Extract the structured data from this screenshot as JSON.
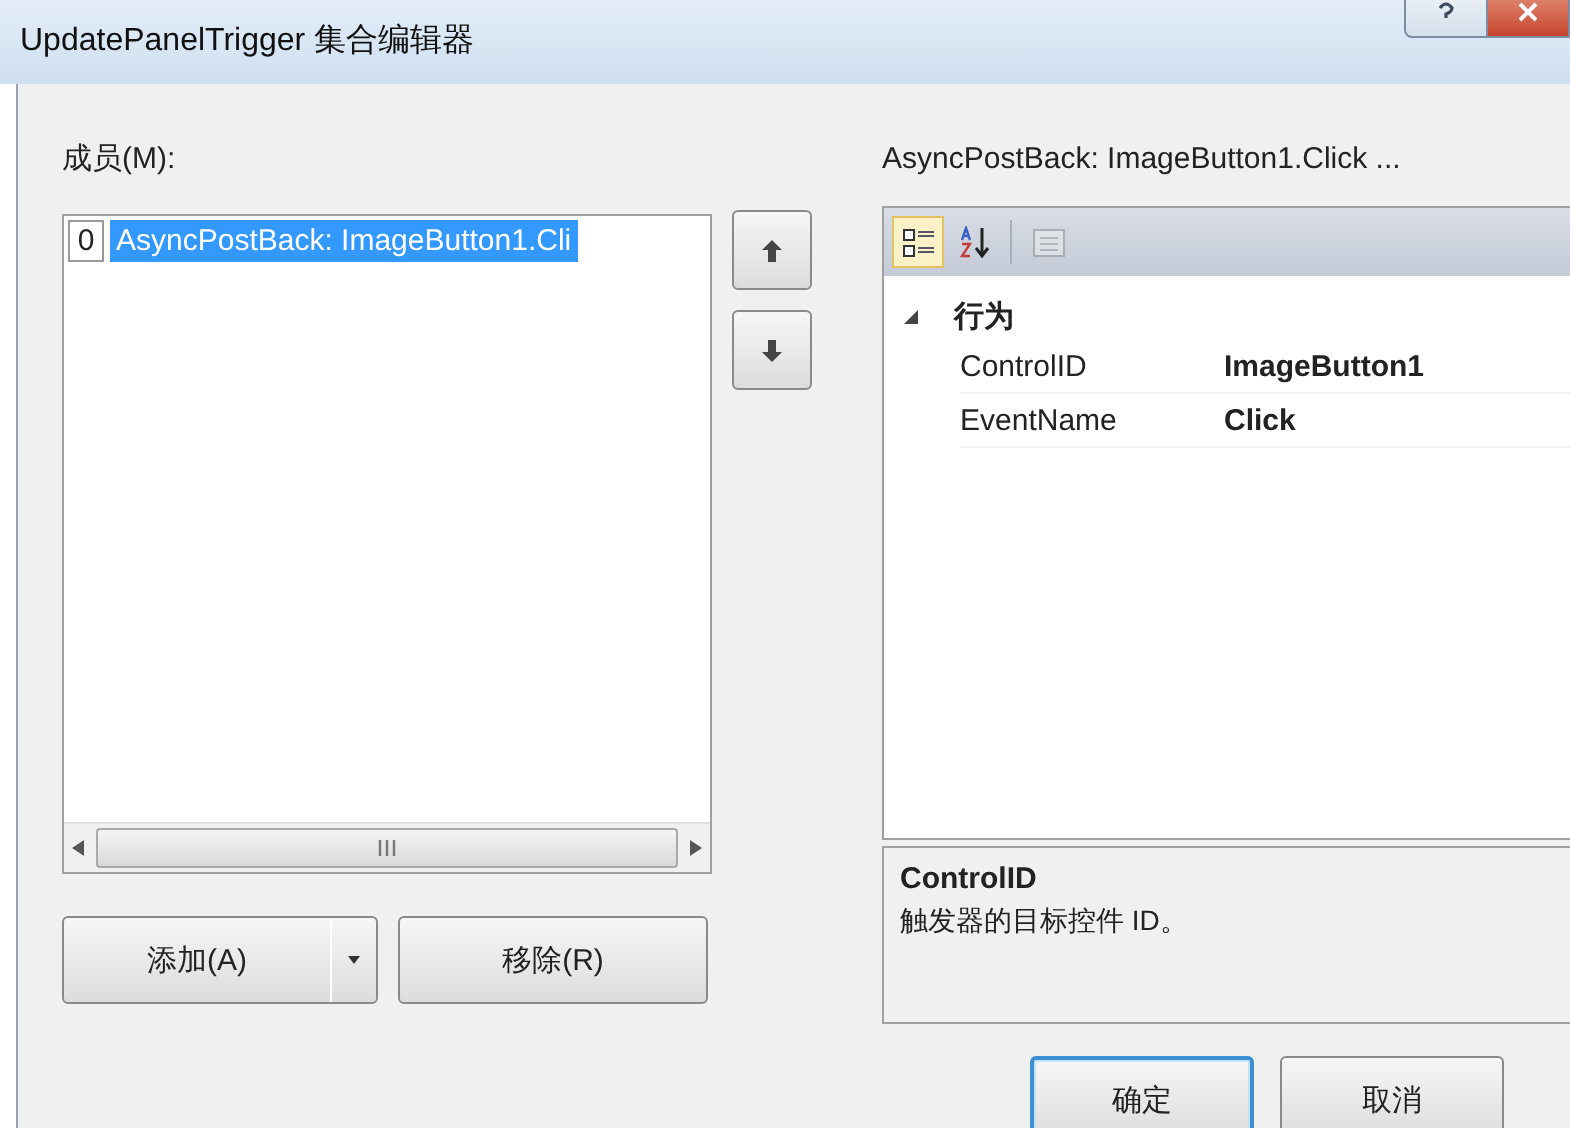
{
  "window": {
    "title": "UpdatePanelTrigger 集合编辑器"
  },
  "members": {
    "label": "成员(M):",
    "items": [
      {
        "index": "0",
        "text": "AsyncPostBack: ImageButton1.Cli",
        "selected": true
      }
    ]
  },
  "properties": {
    "title": "AsyncPostBack: ImageButton1.Click ...",
    "toolbar": [
      {
        "kind": "categorized",
        "selected": true,
        "disabled": false
      },
      {
        "kind": "alphabetical",
        "selected": false,
        "disabled": false
      },
      {
        "kind": "pages",
        "selected": false,
        "disabled": true
      }
    ],
    "categories": [
      {
        "name": "行为",
        "expanded": true,
        "rows": [
          {
            "name": "ControlID",
            "value": "ImageButton1"
          },
          {
            "name": "EventName",
            "value": "Click"
          }
        ]
      }
    ]
  },
  "description": {
    "title": "ControlID",
    "text": "触发器的目标控件 ID。"
  },
  "list_buttons": {
    "add": "添加(A)",
    "remove": "移除(R)"
  },
  "buttons": [
    {
      "label": "确定",
      "default": true
    },
    {
      "label": "取消",
      "default": false
    }
  ]
}
